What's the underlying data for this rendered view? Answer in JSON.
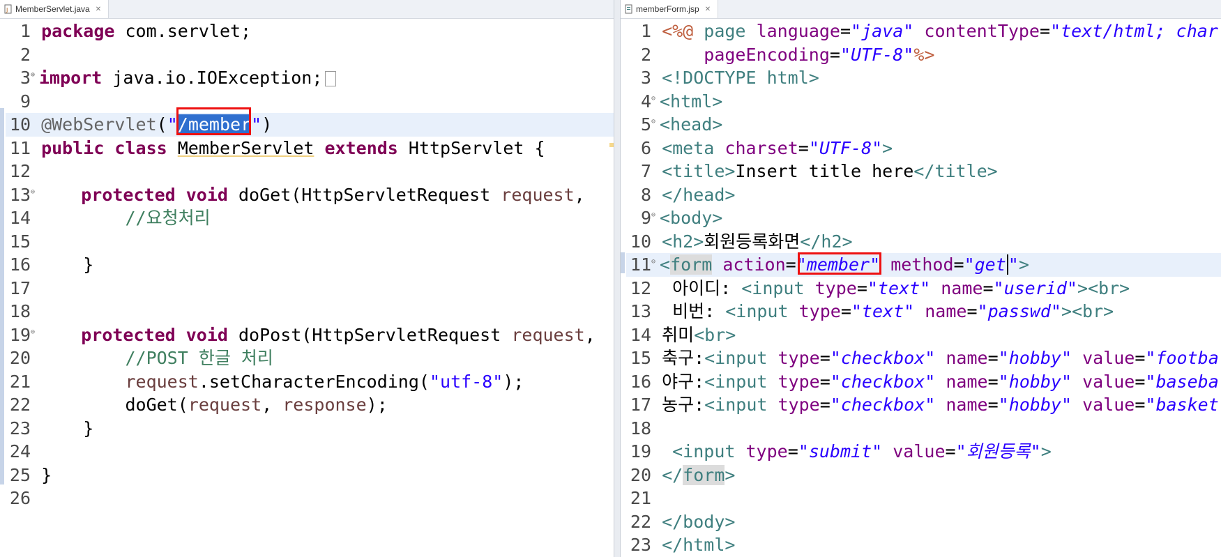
{
  "left_editor": {
    "tab_title": "MemberServlet.java",
    "lines": [
      {
        "n": "1",
        "code": "package com.servlet;"
      },
      {
        "n": "2",
        "code": ""
      },
      {
        "n": "3",
        "code": "import java.io.IOException;"
      },
      {
        "n": "9",
        "code": ""
      },
      {
        "n": "10",
        "code": "@WebServlet(\"/member\")"
      },
      {
        "n": "11",
        "code": "public class MemberServlet extends HttpServlet {"
      },
      {
        "n": "12",
        "code": ""
      },
      {
        "n": "13",
        "code": "    protected void doGet(HttpServletRequest request,"
      },
      {
        "n": "14",
        "code": "        //요청처리"
      },
      {
        "n": "15",
        "code": ""
      },
      {
        "n": "16",
        "code": "    }"
      },
      {
        "n": "17",
        "code": ""
      },
      {
        "n": "18",
        "code": ""
      },
      {
        "n": "19",
        "code": "    protected void doPost(HttpServletRequest request,"
      },
      {
        "n": "20",
        "code": "        //POST 한글 처리"
      },
      {
        "n": "21",
        "code": "        request.setCharacterEncoding(\"utf-8\");"
      },
      {
        "n": "22",
        "code": "        doGet(request, response);"
      },
      {
        "n": "23",
        "code": "    }"
      },
      {
        "n": "24",
        "code": ""
      },
      {
        "n": "25",
        "code": "}"
      },
      {
        "n": "26",
        "code": ""
      }
    ]
  },
  "right_editor": {
    "tab_title": "memberForm.jsp",
    "lines": [
      {
        "n": "1",
        "code": "<%@ page language=\"java\" contentType=\"text/html; char"
      },
      {
        "n": "2",
        "code": "    pageEncoding=\"UTF-8\"%>"
      },
      {
        "n": "3",
        "code": "<!DOCTYPE html>"
      },
      {
        "n": "4",
        "code": "<html>"
      },
      {
        "n": "5",
        "code": "<head>"
      },
      {
        "n": "6",
        "code": "<meta charset=\"UTF-8\">"
      },
      {
        "n": "7",
        "code": "<title>Insert title here</title>"
      },
      {
        "n": "8",
        "code": "</head>"
      },
      {
        "n": "9",
        "code": "<body>"
      },
      {
        "n": "10",
        "code": "<h2>회원등록화면</h2>"
      },
      {
        "n": "11",
        "code": "<form action=\"member\" method=\"get\">"
      },
      {
        "n": "12",
        "code": " 아이디: <input type=\"text\" name=\"userid\"><br>"
      },
      {
        "n": "13",
        "code": " 비번: <input type=\"text\" name=\"passwd\"><br>"
      },
      {
        "n": "14",
        "code": "취미<br>"
      },
      {
        "n": "15",
        "code": "축구:<input type=\"checkbox\" name=\"hobby\" value=\"footba"
      },
      {
        "n": "16",
        "code": "야구:<input type=\"checkbox\" name=\"hobby\" value=\"baseba"
      },
      {
        "n": "17",
        "code": "농구:<input type=\"checkbox\" name=\"hobby\" value=\"basket"
      },
      {
        "n": "18",
        "code": ""
      },
      {
        "n": "19",
        "code": " <input type=\"submit\" value=\"회원등록\">"
      },
      {
        "n": "20",
        "code": "</form>"
      },
      {
        "n": "21",
        "code": ""
      },
      {
        "n": "22",
        "code": "</body>"
      },
      {
        "n": "23",
        "code": "</html>"
      }
    ]
  },
  "colors": {
    "keyword": "#7f0055",
    "string": "#2a00ff",
    "comment": "#3f7f5f",
    "annotation": "#646464",
    "html_tag": "#3f7f7f",
    "html_attr": "#7f007f",
    "highlight_box": "#ee1111",
    "selection": "#2f6fcf"
  }
}
